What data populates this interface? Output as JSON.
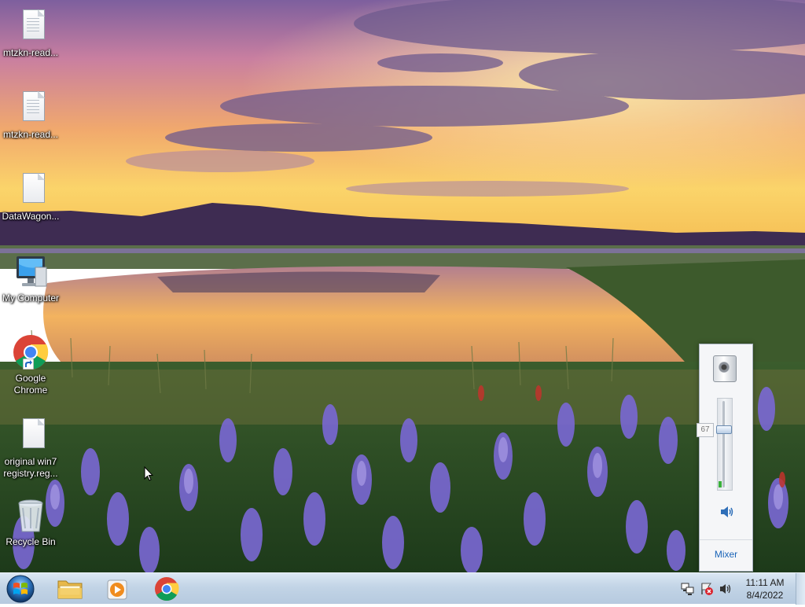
{
  "desktop": {
    "icons": [
      {
        "label": "mtzkn-read...",
        "icon": "text-file-icon"
      },
      {
        "label": "mtzkn-read...",
        "icon": "text-file-icon"
      },
      {
        "label": "DataWagon...",
        "icon": "file-icon"
      },
      {
        "label": "My Computer",
        "icon": "computer-icon"
      },
      {
        "label": "Google\nChrome",
        "icon": "chrome-icon"
      },
      {
        "label": "original win7\nregistry.reg...",
        "icon": "file-icon"
      },
      {
        "label": "Recycle Bin",
        "icon": "recycle-bin-icon"
      }
    ]
  },
  "volume_flyout": {
    "volume_level": 67,
    "tooltip": "67",
    "mixer_label": "Mixer",
    "device_icon": "speaker-device-icon",
    "mute_icon": "speaker-icon"
  },
  "taskbar": {
    "pinned": [
      {
        "name": "windows-explorer",
        "icon": "folder-icon"
      },
      {
        "name": "media-player",
        "icon": "media-player-icon"
      },
      {
        "name": "google-chrome",
        "icon": "chrome-icon"
      }
    ],
    "tray_icons": [
      "network-icon",
      "action-center-icon",
      "volume-icon"
    ],
    "clock": {
      "time": "11:11 AM",
      "date": "8/4/2022"
    }
  },
  "colors": {
    "taskbar": "#c2d4e6",
    "accent_link": "#1a64b8",
    "volume_level_green": "#39b03a"
  }
}
